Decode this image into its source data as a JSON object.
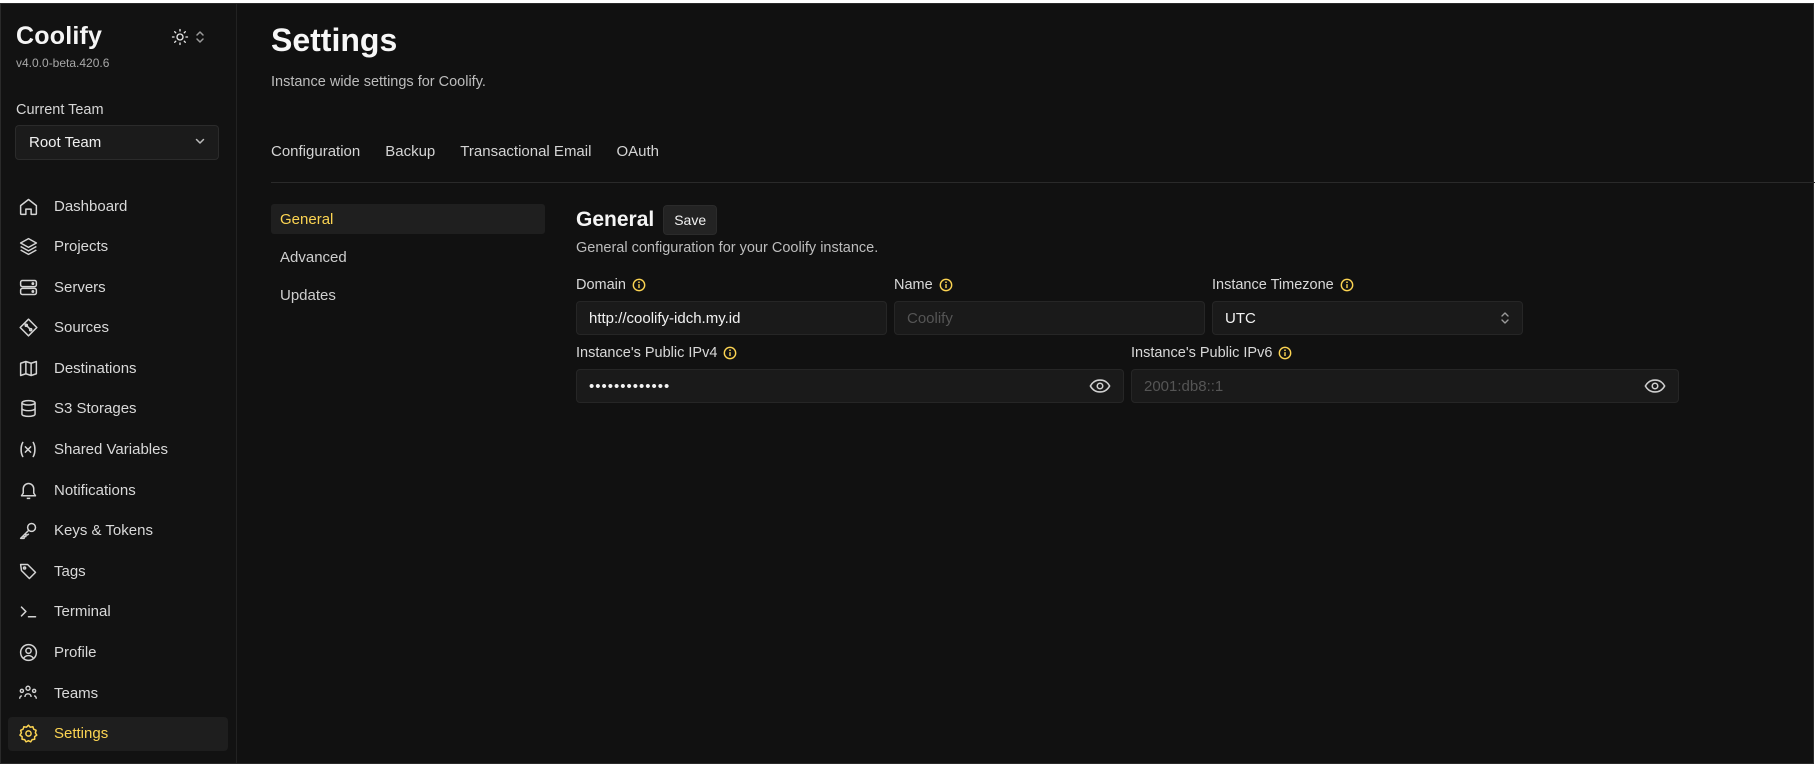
{
  "app": {
    "name": "Coolify",
    "version": "v4.0.0-beta.420.6"
  },
  "team": {
    "label": "Current Team",
    "selected": "Root Team"
  },
  "nav": [
    {
      "label": "Dashboard",
      "icon": "home-icon"
    },
    {
      "label": "Projects",
      "icon": "layers-icon"
    },
    {
      "label": "Servers",
      "icon": "server-icon"
    },
    {
      "label": "Sources",
      "icon": "git-icon"
    },
    {
      "label": "Destinations",
      "icon": "map-icon"
    },
    {
      "label": "S3 Storages",
      "icon": "database-icon"
    },
    {
      "label": "Shared Variables",
      "icon": "variable-icon"
    },
    {
      "label": "Notifications",
      "icon": "bell-icon"
    },
    {
      "label": "Keys & Tokens",
      "icon": "key-icon"
    },
    {
      "label": "Tags",
      "icon": "tag-icon"
    },
    {
      "label": "Terminal",
      "icon": "terminal-icon"
    },
    {
      "label": "Profile",
      "icon": "user-circle-icon"
    },
    {
      "label": "Teams",
      "icon": "users-icon"
    },
    {
      "label": "Settings",
      "icon": "gear-icon",
      "active": true
    }
  ],
  "page": {
    "title": "Settings",
    "subtitle": "Instance wide settings for Coolify."
  },
  "tabs": [
    "Configuration",
    "Backup",
    "Transactional Email",
    "OAuth"
  ],
  "subnav": [
    {
      "label": "General",
      "active": true
    },
    {
      "label": "Advanced"
    },
    {
      "label": "Updates"
    }
  ],
  "section": {
    "title": "General",
    "save_label": "Save",
    "description": "General configuration for your Coolify instance."
  },
  "fields": {
    "domain": {
      "label": "Domain",
      "value": "http://coolify-idch.my.id"
    },
    "name": {
      "label": "Name",
      "value": "",
      "placeholder": "Coolify"
    },
    "timezone": {
      "label": "Instance Timezone",
      "value": "UTC"
    },
    "ipv4": {
      "label": "Instance's Public IPv4",
      "value": "•••••••••••••"
    },
    "ipv6": {
      "label": "Instance's Public IPv6",
      "value": "",
      "placeholder": "2001:db8::1"
    }
  },
  "colors": {
    "accent": "#fcd452",
    "background": "#111111",
    "panel": "#1a1a1a"
  }
}
